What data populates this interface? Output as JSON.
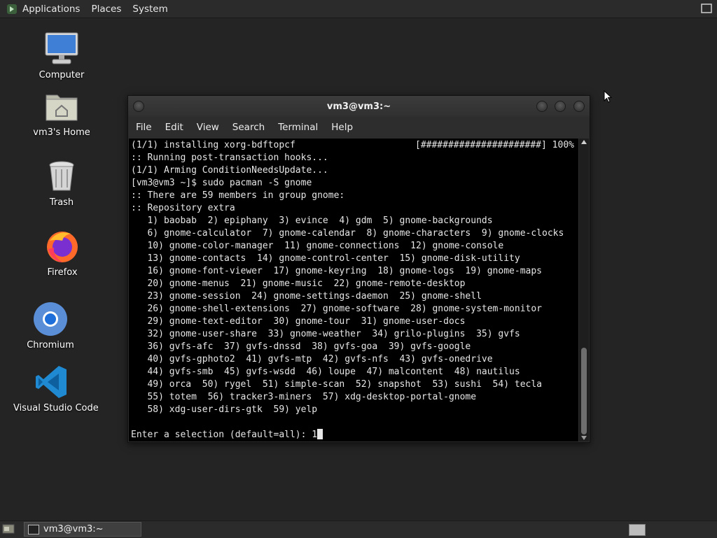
{
  "top_panel": {
    "menus": [
      "Applications",
      "Places",
      "System"
    ]
  },
  "desktop": {
    "icons": [
      {
        "label": "Computer",
        "icon": "computer-icon"
      },
      {
        "label": "vm3's Home",
        "icon": "home-folder-icon"
      },
      {
        "label": "Trash",
        "icon": "trash-icon"
      },
      {
        "label": "Firefox",
        "icon": "firefox-icon"
      },
      {
        "label": "Chromium",
        "icon": "chromium-icon"
      },
      {
        "label": "Visual Studio Code",
        "icon": "vscode-icon"
      }
    ]
  },
  "terminal": {
    "title": "vm3@vm3:~",
    "menu": [
      "File",
      "Edit",
      "View",
      "Search",
      "Terminal",
      "Help"
    ],
    "progress": "[######################] 100%",
    "lines": [
      "(1/1) installing xorg-bdftopcf",
      ":: Running post-transaction hooks...",
      "(1/1) Arming ConditionNeedsUpdate...",
      "[vm3@vm3 ~]$ sudo pacman -S gnome",
      ":: There are 59 members in group gnome:",
      ":: Repository extra",
      "   1) baobab  2) epiphany  3) evince  4) gdm  5) gnome-backgrounds",
      "   6) gnome-calculator  7) gnome-calendar  8) gnome-characters  9) gnome-clocks",
      "   10) gnome-color-manager  11) gnome-connections  12) gnome-console",
      "   13) gnome-contacts  14) gnome-control-center  15) gnome-disk-utility",
      "   16) gnome-font-viewer  17) gnome-keyring  18) gnome-logs  19) gnome-maps",
      "   20) gnome-menus  21) gnome-music  22) gnome-remote-desktop",
      "   23) gnome-session  24) gnome-settings-daemon  25) gnome-shell",
      "   26) gnome-shell-extensions  27) gnome-software  28) gnome-system-monitor",
      "   29) gnome-text-editor  30) gnome-tour  31) gnome-user-docs",
      "   32) gnome-user-share  33) gnome-weather  34) grilo-plugins  35) gvfs",
      "   36) gvfs-afc  37) gvfs-dnssd  38) gvfs-goa  39) gvfs-google",
      "   40) gvfs-gphoto2  41) gvfs-mtp  42) gvfs-nfs  43) gvfs-onedrive",
      "   44) gvfs-smb  45) gvfs-wsdd  46) loupe  47) malcontent  48) nautilus",
      "   49) orca  50) rygel  51) simple-scan  52) snapshot  53) sushi  54) tecla",
      "   55) totem  56) tracker3-miners  57) xdg-desktop-portal-gnome",
      "   58) xdg-user-dirs-gtk  59) yelp"
    ],
    "prompt": "Enter a selection (default=all): ",
    "input": "1",
    "scroll_fraction_visible": 0.3
  },
  "taskbar": {
    "window_title": "vm3@vm3:~"
  }
}
